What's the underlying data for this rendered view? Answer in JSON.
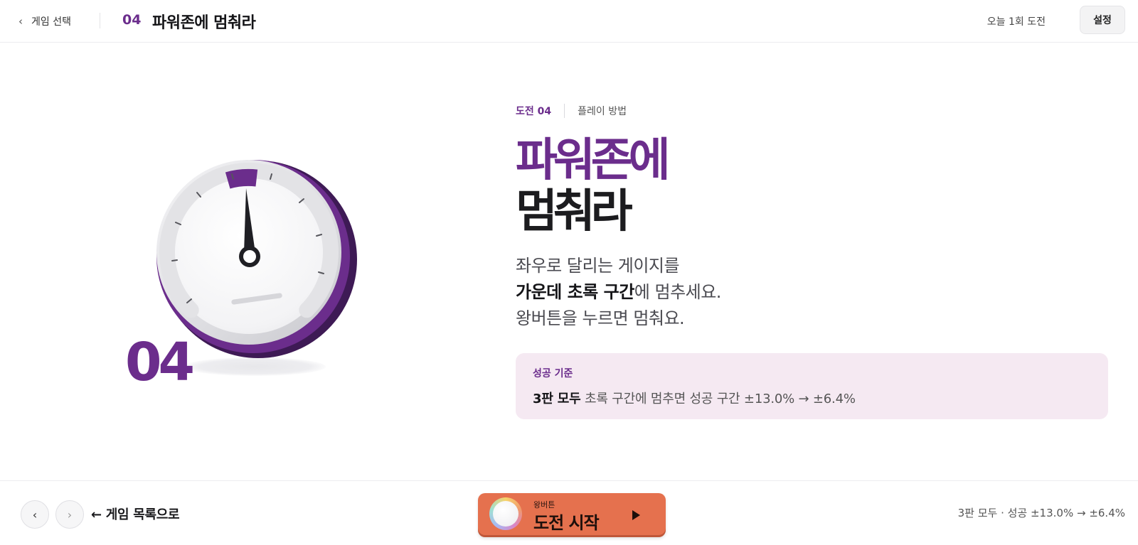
{
  "header": {
    "back_label": "게임 선택",
    "game_number": "04",
    "game_title": "파워존에 멈춰라",
    "daily_count": "오늘 1회 도전",
    "settings_label": "설정"
  },
  "illustration": {
    "number": "04",
    "accent_color": "#6b2d8c"
  },
  "info": {
    "eyebrow_label": "도전 04",
    "eyebrow_sub": "플레이 방법",
    "title_line1": "파워존에",
    "title_line2": "멈춰라",
    "desc_line1": "좌우로 달리는 게이지를",
    "desc_line2_bold": "가운데 초록 구간",
    "desc_line2_rest": "에 멈추세요.",
    "desc_line3": "왕버튼을 누르면 멈춰요."
  },
  "criteria": {
    "title": "성공 기준",
    "bold": "3판 모두",
    "text": " 초록 구간에 멈추면 성공 구간 ±13.0% → ±6.4%"
  },
  "footer": {
    "prev_icon": "‹",
    "next_icon": "›",
    "list_link": "← 게임 목록으로",
    "start_small": "왕버튼",
    "start_big": "도전 시작",
    "status": "3판 모두 · 성공 ±13.0% → ±6.4%"
  },
  "colors": {
    "accent": "#6b2d8c",
    "start_button": "#e5714e",
    "criteria_bg": "#f5e9f2"
  }
}
